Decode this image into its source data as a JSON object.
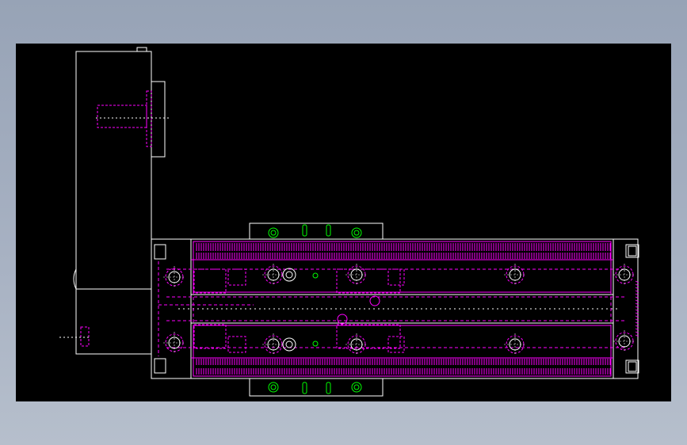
{
  "viewer": {
    "background": "#000000",
    "frame_background": "#9ba6b8"
  },
  "drawing": {
    "type": "CAD mechanical drawing (linear stage with side-mounted motor)",
    "layers": {
      "outline": "#ffffff",
      "hidden": "#ff00ff",
      "holes": "#00ff00",
      "gray": "#a0a0a0"
    },
    "parts": [
      "motor-housing",
      "motor-flange",
      "stage-body",
      "top-rail",
      "bottom-rail",
      "carriage-plate-top",
      "carriage-plate-bottom",
      "end-cap-left",
      "end-cap-right"
    ]
  }
}
